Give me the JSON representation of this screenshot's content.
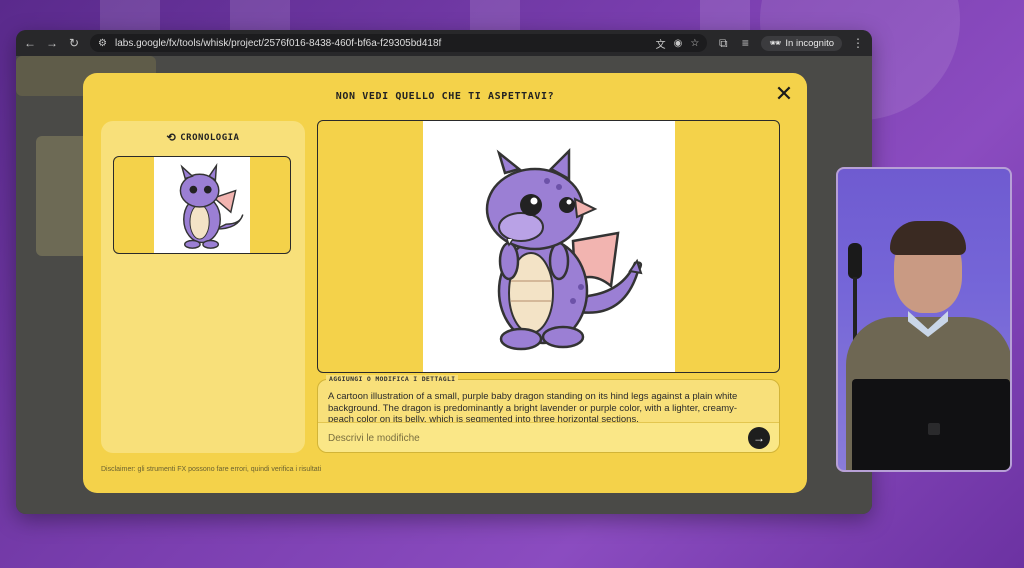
{
  "browser": {
    "url": "labs.google/fx/tools/whisk/project/2576f016-8438-460f-bf6a-f29305bd418f",
    "incognito_label": "In incognito",
    "nav_icons": [
      "back-arrow-icon",
      "forward-arrow-icon",
      "reload-icon",
      "site-settings-icon"
    ],
    "bar_icons": [
      "translate-icon",
      "eye-off-icon",
      "star-icon",
      "extensions-icon",
      "media-icon",
      "incognito-icon",
      "kebab-menu-icon"
    ]
  },
  "modal": {
    "title": "NON VEDI QUELLO CHE TI ASPETTAVI?",
    "close_icon": "close-icon",
    "history": {
      "title": "CRONOLOGIA",
      "icon": "history-icon",
      "thumbnails": [
        {
          "alt": "purple baby dragon thumbnail"
        }
      ]
    },
    "main_image": {
      "alt": "purple baby dragon cartoon"
    },
    "prompt": {
      "label": "AGGIUNGI O MODIFICA I DETTAGLI",
      "text": "A cartoon illustration of a small, purple baby dragon standing on its hind legs against a plain white background. The dragon is predominantly a bright lavender or purple color, with a lighter, creamy-peach color on its belly, which is segmented into three horizontal sections.",
      "edit_placeholder": "Descrivi le modifiche",
      "send_icon": "arrow-right-icon"
    },
    "disclaimer": "Disclaimer: gli strumenti FX possono fare errori, quindi verifica i risultati"
  },
  "colors": {
    "modal_yellow": "#f4d24a",
    "panel_yellow": "#f8e07a",
    "background_purple": "#7b3fb0",
    "dragon_purple": "#9b7fd4",
    "dragon_belly": "#f3e3c6"
  }
}
